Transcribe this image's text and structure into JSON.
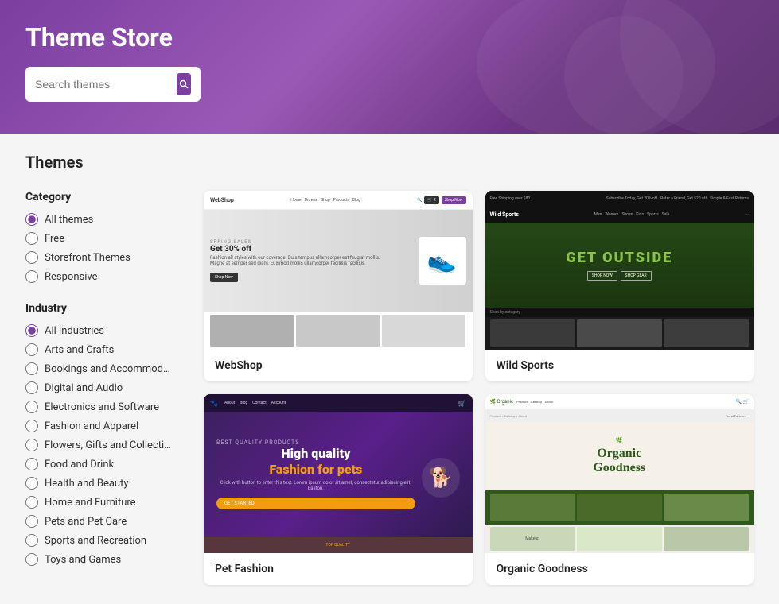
{
  "header": {
    "title": "Theme Store",
    "search_placeholder": "Search themes",
    "search_value": ""
  },
  "main": {
    "section_title": "Themes"
  },
  "sidebar": {
    "category_title": "Category",
    "industry_title": "Industry",
    "category_options": [
      {
        "id": "all",
        "label": "All themes",
        "checked": true
      },
      {
        "id": "free",
        "label": "Free",
        "checked": false
      },
      {
        "id": "storefront",
        "label": "Storefront Themes",
        "checked": false
      },
      {
        "id": "responsive",
        "label": "Responsive",
        "checked": false
      }
    ],
    "industry_options": [
      {
        "id": "all-ind",
        "label": "All industries",
        "checked": true
      },
      {
        "id": "arts",
        "label": "Arts and Crafts",
        "checked": false
      },
      {
        "id": "bookings",
        "label": "Bookings and Accommodat...",
        "checked": false
      },
      {
        "id": "digital",
        "label": "Digital and Audio",
        "checked": false
      },
      {
        "id": "electronics",
        "label": "Electronics and Software",
        "checked": false
      },
      {
        "id": "fashion",
        "label": "Fashion and Apparel",
        "checked": false
      },
      {
        "id": "flowers",
        "label": "Flowers, Gifts and Collecti...",
        "checked": false
      },
      {
        "id": "food",
        "label": "Food and Drink",
        "checked": false
      },
      {
        "id": "health",
        "label": "Health and Beauty",
        "checked": false
      },
      {
        "id": "home",
        "label": "Home and Furniture",
        "checked": false
      },
      {
        "id": "pets",
        "label": "Pets and Pet Care",
        "checked": false
      },
      {
        "id": "sports",
        "label": "Sports and Recreation",
        "checked": false
      },
      {
        "id": "toys",
        "label": "Toys and Games",
        "checked": false
      }
    ]
  },
  "themes": [
    {
      "id": "webshop",
      "name": "WebShop",
      "hero_text": "SPRING SALES",
      "hero_subtitle": "Get 30% off",
      "preview_type": "webshop"
    },
    {
      "id": "wild-sports",
      "name": "Wild Sports",
      "hero_text": "GET OUTSIDE",
      "preview_type": "wildsports"
    },
    {
      "id": "pet-fashion",
      "name": "Pet Fashion",
      "hero_title": "High quality",
      "hero_title2": "Fashion for pets",
      "preview_type": "petfashion"
    },
    {
      "id": "organic",
      "name": "Organic Goodness",
      "hero_text": "Organic Goodness",
      "preview_type": "organic"
    }
  ],
  "icons": {
    "search": "🔍",
    "radio_checked": "●",
    "radio_unchecked": "○"
  }
}
